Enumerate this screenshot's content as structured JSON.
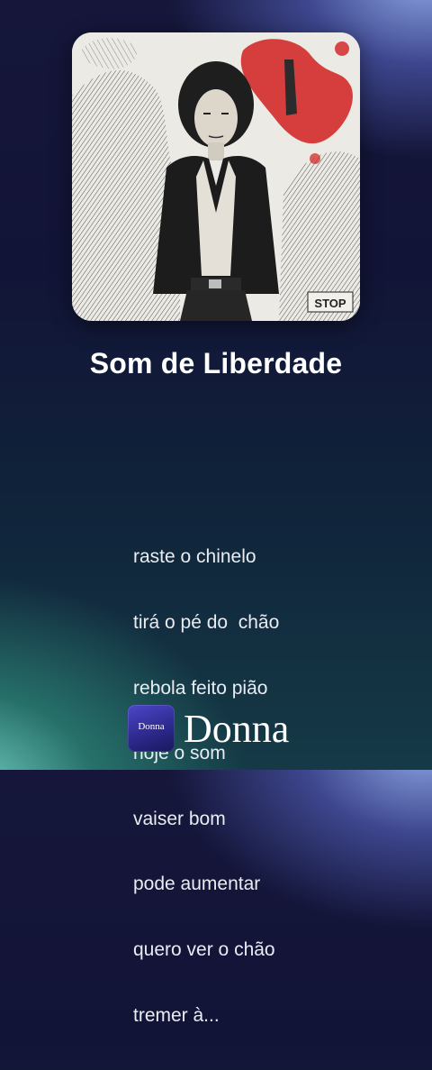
{
  "song": {
    "title": "Som de Liberdade"
  },
  "cover": {
    "poster_text": "STOP",
    "accent_color": "#d42a2a"
  },
  "lyrics": [
    "raste o chinelo",
    "tirá o pé do  chão",
    "rebola feito pião",
    "hoje o som",
    "vaiser bom",
    "pode aumentar",
    "quero ver o chão",
    "tremer à..."
  ],
  "brand": {
    "logo_text": "Donna",
    "name": "Donna",
    "colors": {
      "logo_top": "#4d47c9",
      "logo_bottom": "#18185a"
    }
  }
}
